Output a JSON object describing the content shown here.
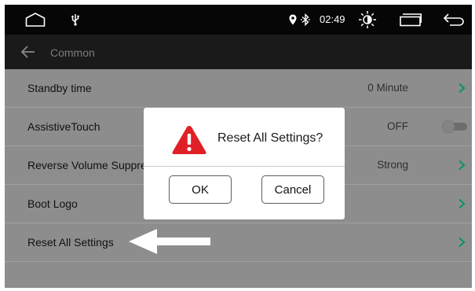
{
  "statusbar": {
    "time": "02:49",
    "icons": [
      "home-outline-icon",
      "usb-icon",
      "location-icon",
      "bluetooth-icon",
      "brightness-icon",
      "recent-apps-icon",
      "back-icon"
    ]
  },
  "titlebar": {
    "back_icon": "arrow-left-icon",
    "title": "Common"
  },
  "settings": {
    "items": [
      {
        "label": "Standby time",
        "value": "0 Minute",
        "control": "chevron"
      },
      {
        "label": "AssistiveTouch",
        "value": "OFF",
        "control": "toggle",
        "toggle_on": false
      },
      {
        "label": "Reverse Volume Suppre",
        "value": "Strong",
        "control": "chevron"
      },
      {
        "label": "Boot Logo",
        "value": "",
        "control": "chevron"
      },
      {
        "label": "Reset All Settings",
        "value": "",
        "control": "chevron"
      }
    ]
  },
  "dialog": {
    "icon": "warning-icon",
    "title": "Reset All Settings?",
    "ok_label": "OK",
    "cancel_label": "Cancel"
  },
  "annotation": {
    "icon": "pointer-arrow-icon",
    "points_to": "Reset All Settings"
  },
  "colors": {
    "chevron": "#0f9560",
    "warning": "#e02027",
    "list_background": "#8d8d8d",
    "statusbar": "#060606",
    "titlebar": "#1a1a1a"
  }
}
